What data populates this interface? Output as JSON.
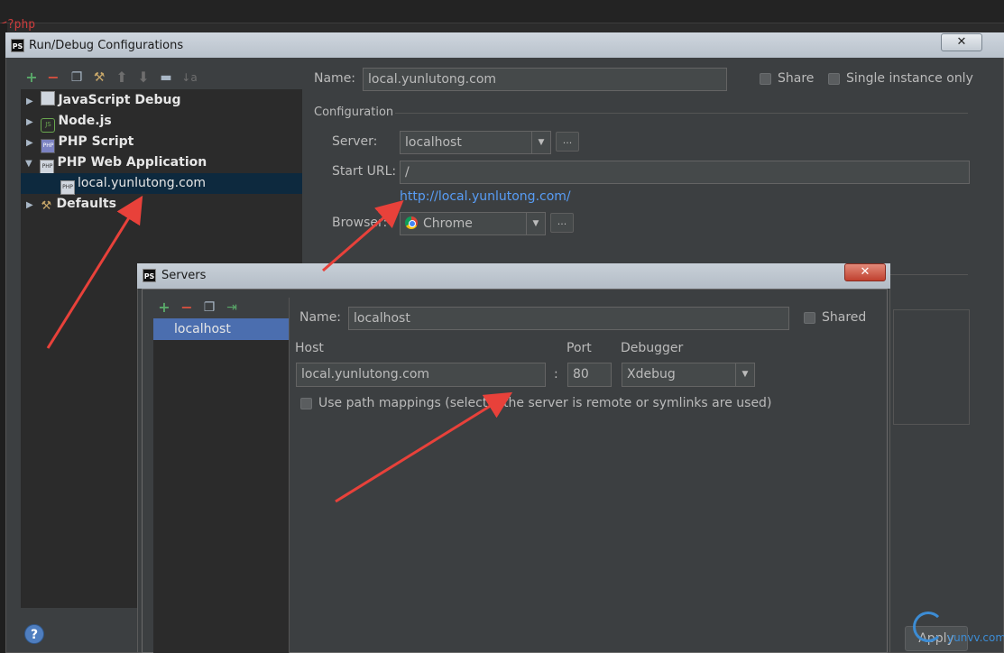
{
  "editor": {
    "code": "<?php"
  },
  "main_dialog": {
    "title": "Run/Debug Configurations",
    "close_label": "✕",
    "toolbar": [
      "add-icon",
      "remove-icon",
      "copy-icon",
      "wrench-icon",
      "move-up-icon",
      "move-down-icon",
      "folder-icon",
      "sort-icon"
    ],
    "tree": [
      {
        "label": "JavaScript Debug",
        "expanded": false,
        "icon": "js-debug-icon"
      },
      {
        "label": "Node.js",
        "expanded": false,
        "icon": "nodejs-icon"
      },
      {
        "label": "PHP Script",
        "expanded": false,
        "icon": "php-script-icon"
      },
      {
        "label": "PHP Web Application",
        "expanded": true,
        "icon": "php-web-icon"
      },
      {
        "label": "local.yunlutong.com",
        "selected": true,
        "icon": "php-web-icon"
      },
      {
        "label": "Defaults",
        "expanded": false,
        "icon": "wrench-icon"
      }
    ],
    "name_label": "Name:",
    "name_value": "local.yunlutong.com",
    "share_label": "Share",
    "single_instance_label": "Single instance only",
    "configuration_label": "Configuration",
    "server_label": "Server:",
    "server_value": "localhost",
    "start_url_label": "Start URL:",
    "start_url_value": "/",
    "url_link": "http://local.yunlutong.com/",
    "browser_label": "Browser:",
    "browser_value": "Chrome",
    "dots": "...",
    "help_label": "?",
    "apply_label": "Apply"
  },
  "servers_dialog": {
    "title": "Servers",
    "close_label": "✕",
    "toolbar": [
      "add-icon",
      "remove-icon",
      "copy-icon",
      "import-icon"
    ],
    "servers": [
      "localhost"
    ],
    "name_label": "Name:",
    "name_value": "localhost",
    "shared_label": "Shared",
    "host_label": "Host",
    "host_value": "local.yunlutong.com",
    "colon": ":",
    "port_label": "Port",
    "port_value": "80",
    "debugger_label": "Debugger",
    "debugger_value": "Xdebug",
    "path_mappings_label": "Use path mappings (select if the server is remote or symlinks are used)"
  },
  "watermark": {
    "text": "yunvv.com"
  },
  "colors": {
    "accent_link": "#589df6",
    "selection": "#0d293e",
    "list_selection": "#4b6eaf",
    "annotation_arrow": "#e8413a"
  }
}
